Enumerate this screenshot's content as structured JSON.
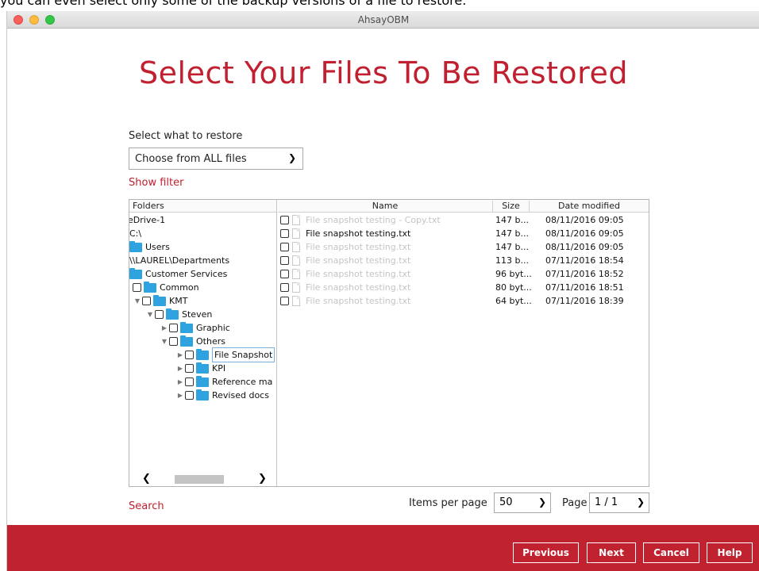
{
  "doc_caption": "you can even select only some of the backup versions of a file to restore.",
  "window": {
    "title": "AhsayOBM"
  },
  "page_title": "Select Your Files To Be Restored",
  "restore_select": {
    "label": "Select what to restore",
    "value": "Choose from ALL files"
  },
  "show_filter": "Show filter",
  "tree": {
    "header": "Folders",
    "items": [
      {
        "label": "eDrive-1"
      },
      {
        "label": "C:\\"
      },
      {
        "label": "Users"
      },
      {
        "label": "\\\\LAUREL\\Departments"
      },
      {
        "label": "Customer Services"
      },
      {
        "label": "Common"
      },
      {
        "label": "KMT"
      },
      {
        "label": "Steven"
      },
      {
        "label": "Graphic"
      },
      {
        "label": "Others"
      },
      {
        "label": "File Snapshot"
      },
      {
        "label": "KPI"
      },
      {
        "label": "Reference ma"
      },
      {
        "label": "Revised docs"
      }
    ]
  },
  "files": {
    "columns": {
      "name": "Name",
      "size": "Size",
      "date": "Date modified"
    },
    "rows": [
      {
        "name": "File snapshot testing - Copy.txt",
        "size": "147 b...",
        "date": "08/11/2016 09:05"
      },
      {
        "name": "File snapshot testing.txt",
        "size": "147 b...",
        "date": "08/11/2016 09:05"
      },
      {
        "name": "File snapshot testing.txt",
        "size": "147 b...",
        "date": "08/11/2016 09:05"
      },
      {
        "name": "File snapshot testing.txt",
        "size": "113 b...",
        "date": "07/11/2016 18:54"
      },
      {
        "name": "File snapshot testing.txt",
        "size": "96 byt...",
        "date": "07/11/2016 18:52"
      },
      {
        "name": "File snapshot testing.txt",
        "size": "80 byt...",
        "date": "07/11/2016 18:51"
      },
      {
        "name": "File snapshot testing.txt",
        "size": "64 byt...",
        "date": "07/11/2016 18:39"
      }
    ]
  },
  "search_link": "Search",
  "pagination": {
    "items_label": "Items per page",
    "items_value": "50",
    "page_label": "Page",
    "page_value": "1 / 1"
  },
  "buttons": {
    "previous": "Previous",
    "next": "Next",
    "cancel": "Cancel",
    "help": "Help"
  },
  "icons": {
    "folder": "folder-icon",
    "file": "file-icon",
    "chevron": "chevron-down-icon",
    "expand": "triangle-icon"
  },
  "colors": {
    "accent_red": "#c0202f",
    "folder_blue": "#2fa2e0"
  }
}
